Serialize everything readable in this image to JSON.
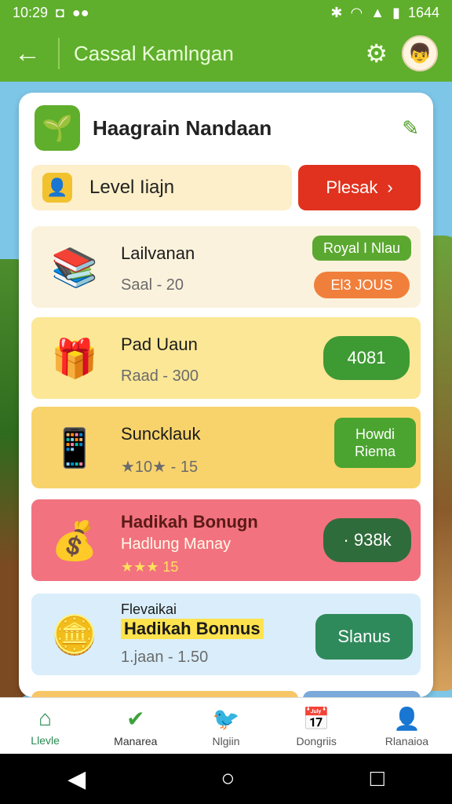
{
  "status_bar": {
    "time": "10:29",
    "battery": "1644"
  },
  "app_bar": {
    "title": "Cassal Kamlngan"
  },
  "panel": {
    "title": "Haagrain Nandaan",
    "level_label": "Level Iiajn",
    "level_button": "Plesak"
  },
  "cards": [
    {
      "name": "Lailvanan",
      "sub": "Saal - 20",
      "tag1": "Royal I Nlau",
      "tag2": "El3 JOUS"
    },
    {
      "name": "Pad Uaun",
      "sub": "Raad - 300",
      "action": "4081"
    },
    {
      "name": "Suncklauk",
      "sub": "★10★ - 15",
      "action_line1": "Howdi",
      "action_line2": "Riema"
    },
    {
      "name": "Hadikah Bonugn",
      "sub": "Hadlung Manay",
      "rating": "★★★ 15",
      "action": "· 938k"
    },
    {
      "name_small": "Flevaikai",
      "name": "Hadikah Bonnus",
      "sub": "1.jaan - 1.50",
      "action": "Slanus"
    }
  ],
  "nav": [
    {
      "label": "Llevle",
      "color": "#2a8a52"
    },
    {
      "label": "Manarea",
      "color": "#333"
    },
    {
      "label": "Nlgiin",
      "color": "#555"
    },
    {
      "label": "Dongriis",
      "color": "#555"
    },
    {
      "label": "Rlanaioa",
      "color": "#555"
    }
  ]
}
